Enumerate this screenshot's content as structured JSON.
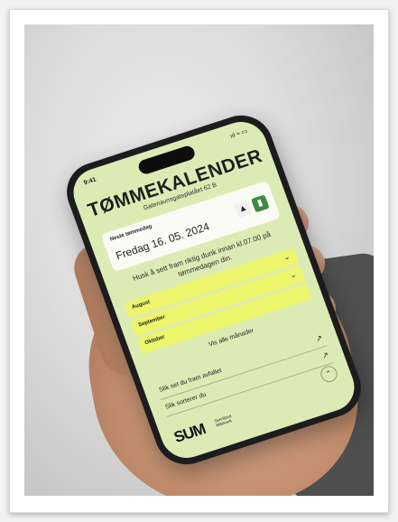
{
  "status": {
    "time": "9:41",
    "icons": "ııl ≈ ▭"
  },
  "app": {
    "title": "TØMMEKALENDER",
    "address": "Gatenavnsgateplatået 62 B"
  },
  "next_pickup": {
    "label": "Neste tømmedag",
    "date": "Fredag 16. 05. 2024",
    "icon_a": "bag-icon",
    "icon_b": "bin-icon"
  },
  "reminder": "Husk å sett fram riktig dunk innan kl.07.00 på tømmedagen din.",
  "months": [
    {
      "label": "August"
    },
    {
      "label": "September"
    },
    {
      "label": "Oktober"
    }
  ],
  "show_all": "Vis alle månader",
  "links": [
    {
      "label": "Slik set du fram avfallet"
    },
    {
      "label": "Slik sorterer du"
    }
  ],
  "brand": {
    "logo": "SUM",
    "name_line1": "Sunnfjord",
    "name_line2": "Miljøverk"
  },
  "colors": {
    "screen_bg": "#dcebb4",
    "month_highlight": "#ecf56c",
    "bin_green": "#3b8d3f"
  }
}
